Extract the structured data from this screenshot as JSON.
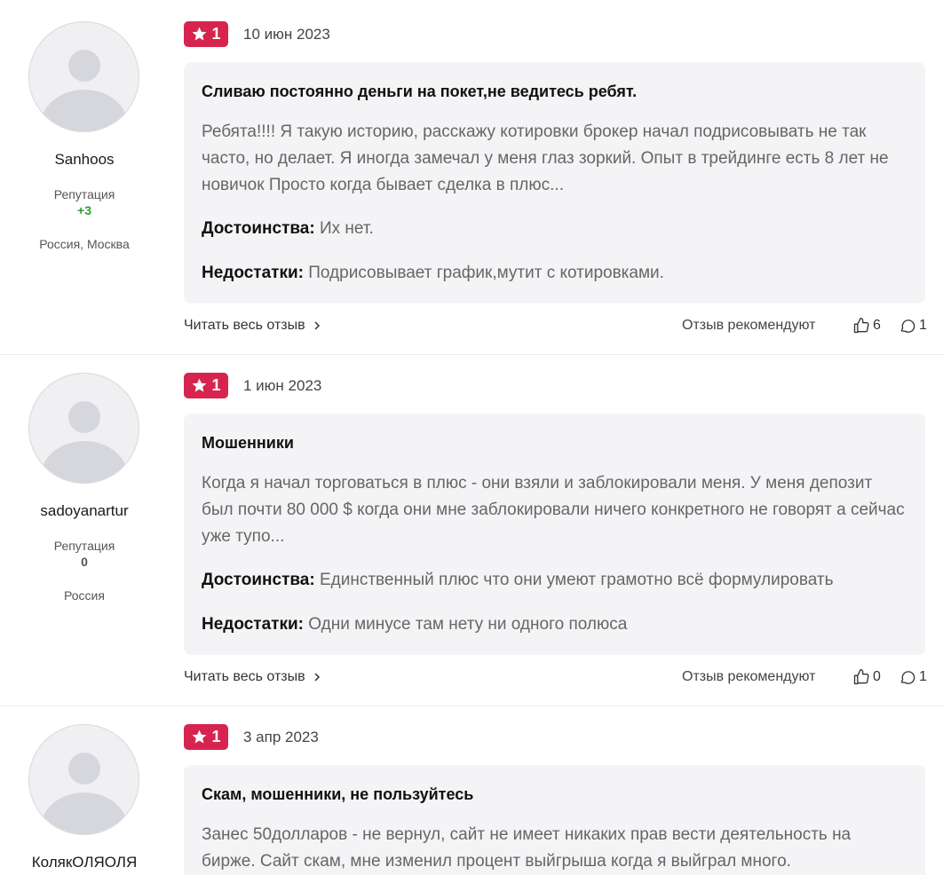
{
  "reviews": [
    {
      "user": {
        "name": "Sanhoos",
        "reputation_label": "Репутация",
        "reputation": "+3",
        "location": "Россия, Москва"
      },
      "rating": "1",
      "date": "10 июн 2023",
      "title": "Сливаю постоянно деньги на покет,не ведитесь ребят.",
      "text": "Ребята!!!! Я такую историю, расскажу котировки брокер начал подрисовывать не так часто, но делает. Я иногда замечал у меня глаз зоркий. Опыт в трейдинге есть 8 лет не новичок Просто когда бывает сделка в плюс...",
      "pros_label": "Достоинства:",
      "pros": " Их нет.",
      "cons_label": "Недостатки:",
      "cons": " Подрисовывает график,мутит с котировками.",
      "read_more": "Читать весь отзыв",
      "recommend": "Отзыв рекомендуют",
      "likes": "6",
      "comments": "1"
    },
    {
      "user": {
        "name": "sadoyanartur",
        "reputation_label": "Репутация",
        "reputation": "0",
        "location": "Россия"
      },
      "rating": "1",
      "date": "1 июн 2023",
      "title": "Мошенники",
      "text": "Когда я начал торговаться в плюс - они взяли и заблокировали меня. У меня депозит был почти 80 000 $ когда они мне заблокировали ничего конкретного не говорят а сейчас уже тупо...",
      "pros_label": "Достоинства:",
      "pros": " Единственный плюс что они умеют грамотно всё формулировать",
      "cons_label": "Недостатки:",
      "cons": " Одни минусе там нету ни одного полюса",
      "read_more": "Читать весь отзыв",
      "recommend": "Отзыв рекомендуют",
      "likes": "0",
      "comments": "1"
    },
    {
      "user": {
        "name": "КолякОЛЯОЛЯ"
      },
      "rating": "1",
      "date": "3 апр 2023",
      "title": "Скам, мошенники, не пользуйтесь",
      "text": "Занес 50долларов - не вернул, сайт не имеет никаких прав вести деятельность на бирже. Сайт скам, мне изменил процент выйгрыша когда я выйграл много."
    }
  ],
  "colors": {
    "badge": "#d6244f",
    "positive_reputation": "#2aa02a",
    "card_bg": "#f4f4f6"
  },
  "icons": [
    "user-avatar-placeholder",
    "star-icon",
    "chevron-right-icon",
    "thumbs-up-icon",
    "comment-icon"
  ]
}
